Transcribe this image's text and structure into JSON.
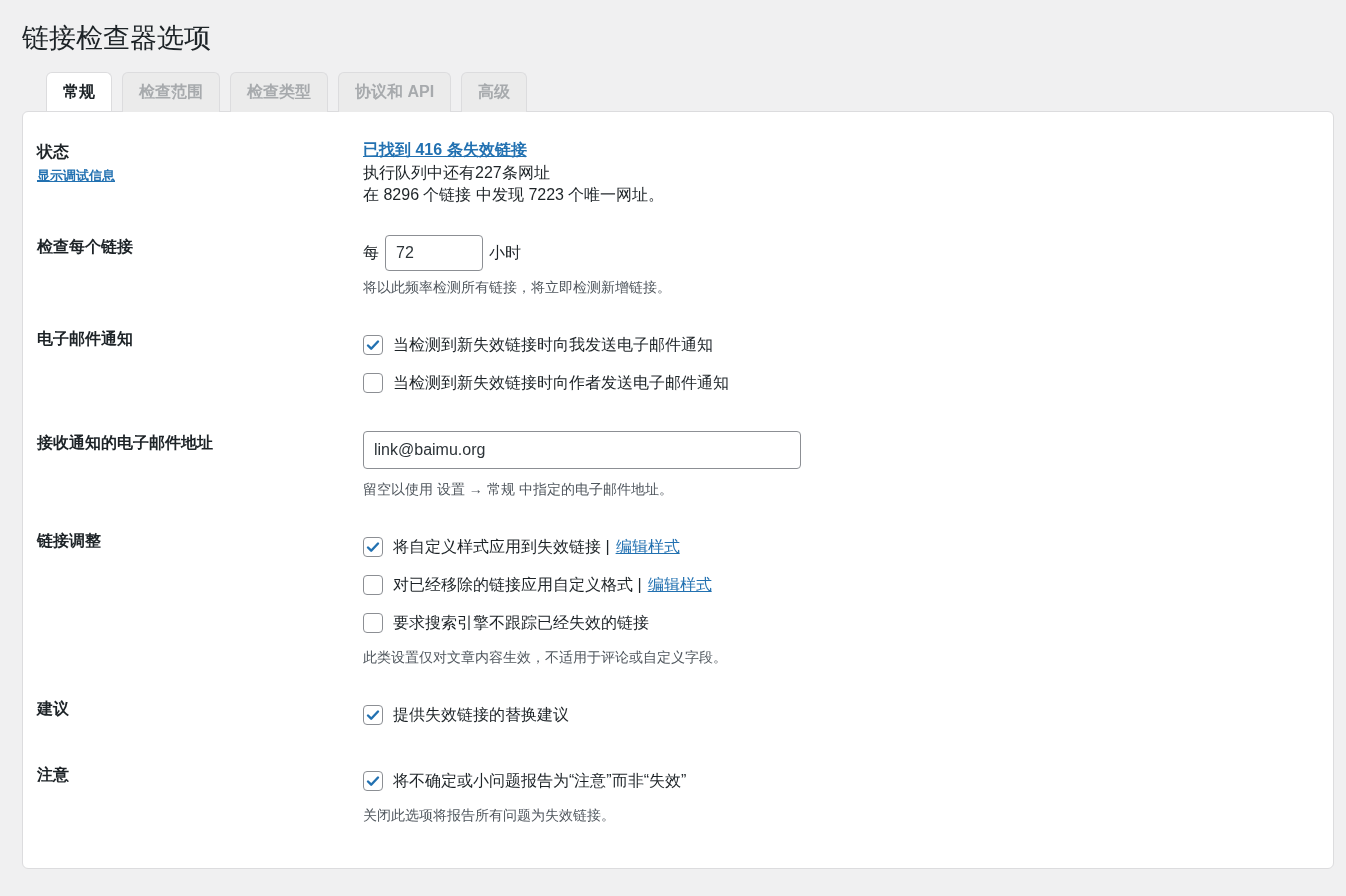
{
  "title": "链接检查器选项",
  "tabs": [
    {
      "label": "常规",
      "selected": true
    },
    {
      "label": "检查范围",
      "selected": false
    },
    {
      "label": "检查类型",
      "selected": false
    },
    {
      "label": "协议和 API",
      "selected": false
    },
    {
      "label": "高级",
      "selected": false
    }
  ],
  "sections": [
    {
      "label": "状态",
      "label_link": "显示调试信息",
      "items": [
        {
          "kind": "link",
          "text": "已找到 416 条失效链接"
        },
        {
          "kind": "text",
          "text": "执行队列中还有227条网址"
        },
        {
          "kind": "text",
          "text": "在 8296 个链接 中发现 7223 个唯一网址。"
        }
      ]
    },
    {
      "label": "检查每个链接",
      "items": [
        {
          "kind": "inline_field",
          "prefix": "每",
          "value": "72",
          "suffix": "小时"
        },
        {
          "kind": "note",
          "text": "将以此频率检测所有链接，将立即检测新增链接。"
        }
      ]
    },
    {
      "label": "电子邮件通知",
      "items": [
        {
          "kind": "checkbox",
          "text": "当检测到新失效链接时向我发送电子邮件通知",
          "checked": true
        },
        {
          "kind": "checkbox",
          "text": "当检测到新失效链接时向作者发送电子邮件通知",
          "checked": false
        }
      ]
    },
    {
      "label": "接收通知的电子邮件地址",
      "items": [
        {
          "kind": "field",
          "value": "link@baimu.org"
        },
        {
          "kind": "note",
          "text": "留空以使用 设置 → 常规 中指定的电子邮件地址。"
        }
      ]
    },
    {
      "label": "链接调整",
      "items": [
        {
          "kind": "checkbox",
          "text": "将自定义样式应用到失效链接 |",
          "link": "编辑样式",
          "checked": true
        },
        {
          "kind": "checkbox",
          "text": "对已经移除的链接应用自定义格式 |",
          "link": "编辑样式",
          "checked": false
        },
        {
          "kind": "checkbox",
          "text": "要求搜索引擎不跟踪已经失效的链接",
          "checked": false
        },
        {
          "kind": "note",
          "text": "此类设置仅对文章内容生效，不适用于评论或自定义字段。"
        }
      ]
    },
    {
      "label": "建议",
      "items": [
        {
          "kind": "checkbox",
          "text": "提供失效链接的替换建议",
          "checked": true
        }
      ]
    },
    {
      "label": "注意",
      "items": [
        {
          "kind": "checkbox",
          "text": "将不确定或小问题报告为“注意”而非“失效”",
          "checked": true
        },
        {
          "kind": "note",
          "text": "关闭此选项将报告所有问题为失效链接。"
        }
      ]
    }
  ]
}
